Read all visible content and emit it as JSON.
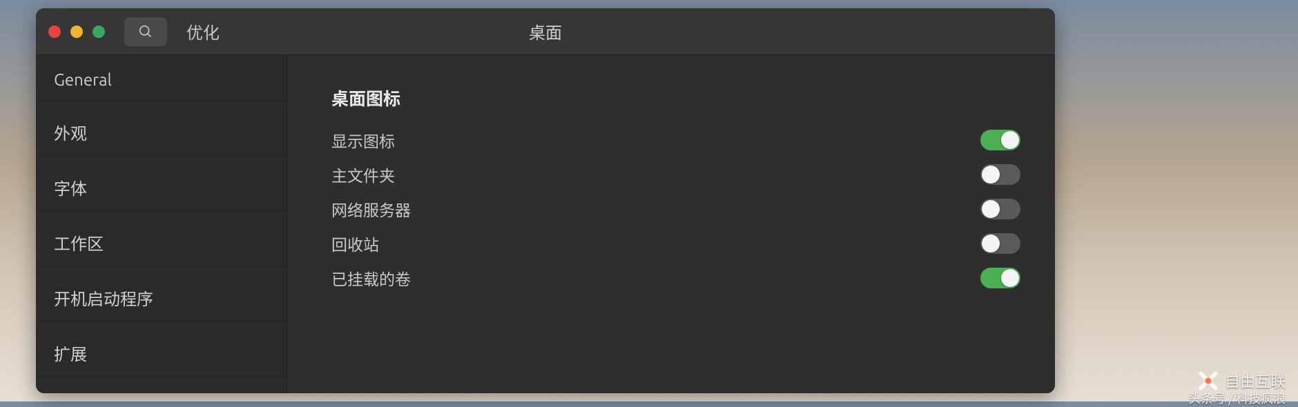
{
  "titlebar": {
    "app_name": "优化",
    "window_title": "桌面"
  },
  "sidebar": {
    "items": [
      {
        "label": "General"
      },
      {
        "label": "外观"
      },
      {
        "label": "字体"
      },
      {
        "label": "工作区"
      },
      {
        "label": "开机启动程序"
      },
      {
        "label": "扩展"
      }
    ]
  },
  "main": {
    "section_title": "桌面图标",
    "settings": [
      {
        "label": "显示图标",
        "on": true
      },
      {
        "label": "主文件夹",
        "on": false
      },
      {
        "label": "网络服务器",
        "on": false
      },
      {
        "label": "回收站",
        "on": false
      },
      {
        "label": "已挂载的卷",
        "on": true
      }
    ]
  },
  "watermark": {
    "brand": "自由互联",
    "sub": "头条号 / 科技疯浪"
  }
}
